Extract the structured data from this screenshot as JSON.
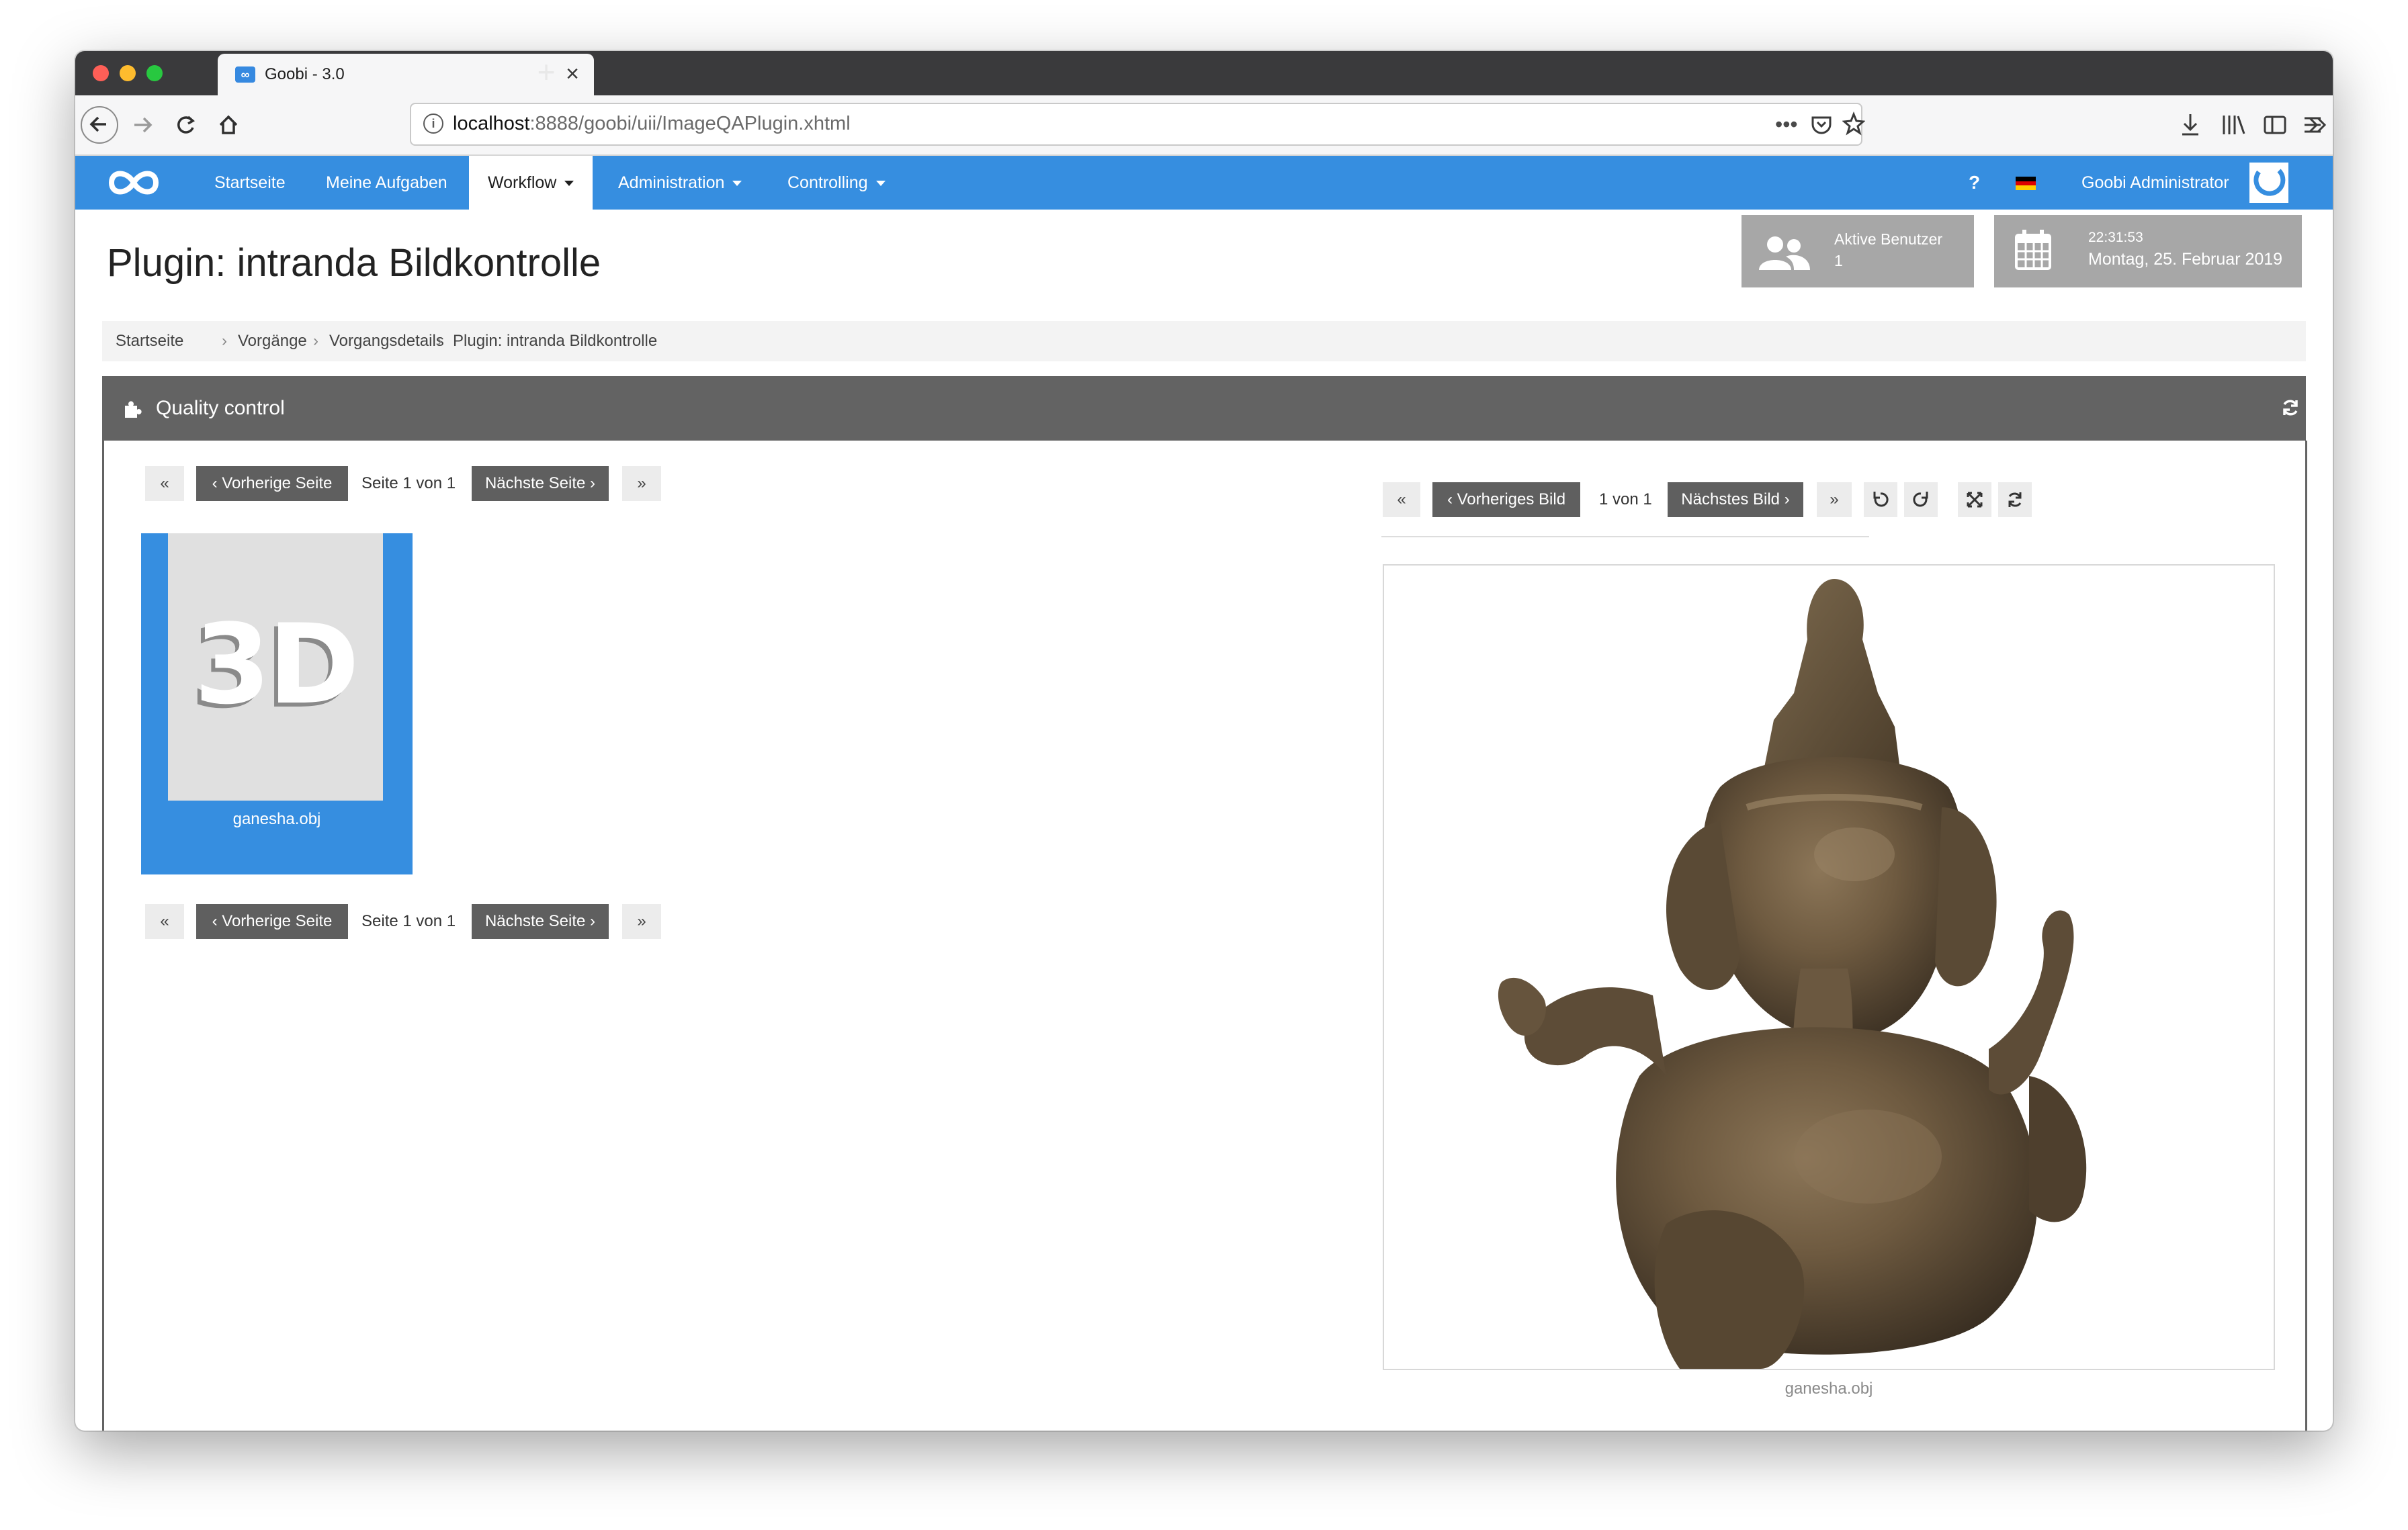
{
  "browser": {
    "tab_title": "Goobi - 3.0",
    "tab_favicon": "∞",
    "tab_close_icon": "×",
    "new_tab_icon": "+",
    "url_host": "localhost",
    "url_rest": ":8888/goobi/uii/ImageQAPlugin.xhtml",
    "colors": {
      "chrome_dark": "#3a3a3c",
      "close": "#fe5f57",
      "minimize": "#febc2e",
      "zoom": "#28c840"
    }
  },
  "app": {
    "brand_color": "#368ee0",
    "nav": {
      "items": [
        "Startseite",
        "Meine Aufgaben",
        "Workflow",
        "Administration",
        "Controlling"
      ],
      "help": "?",
      "user": "Goobi Administrator"
    },
    "title": "Plugin: intranda Bildkontrolle",
    "active_users": {
      "label": "Aktive Benutzer",
      "count": "1"
    },
    "clock": {
      "time": "22:31:53",
      "date": "Montag, 25. Februar 2019"
    },
    "breadcrumb": [
      "Startseite",
      "Vorgänge",
      "Vorgangsdetails",
      "Plugin: intranda Bildkontrolle"
    ],
    "panel": {
      "title": "Quality control"
    },
    "pager": {
      "first": "«",
      "prev": "‹ Vorherige Seite",
      "status": "Seite 1 von 1",
      "next": "Nächste Seite ›",
      "last": "»"
    },
    "thumbnail": {
      "badge": "3D",
      "filename": "ganesha.obj"
    },
    "viewer": {
      "first": "«",
      "prev": "‹ Vorheriges Bild",
      "status": "1 von 1",
      "next": "Nächstes Bild ›",
      "last": "»",
      "caption": "ganesha.obj"
    }
  }
}
